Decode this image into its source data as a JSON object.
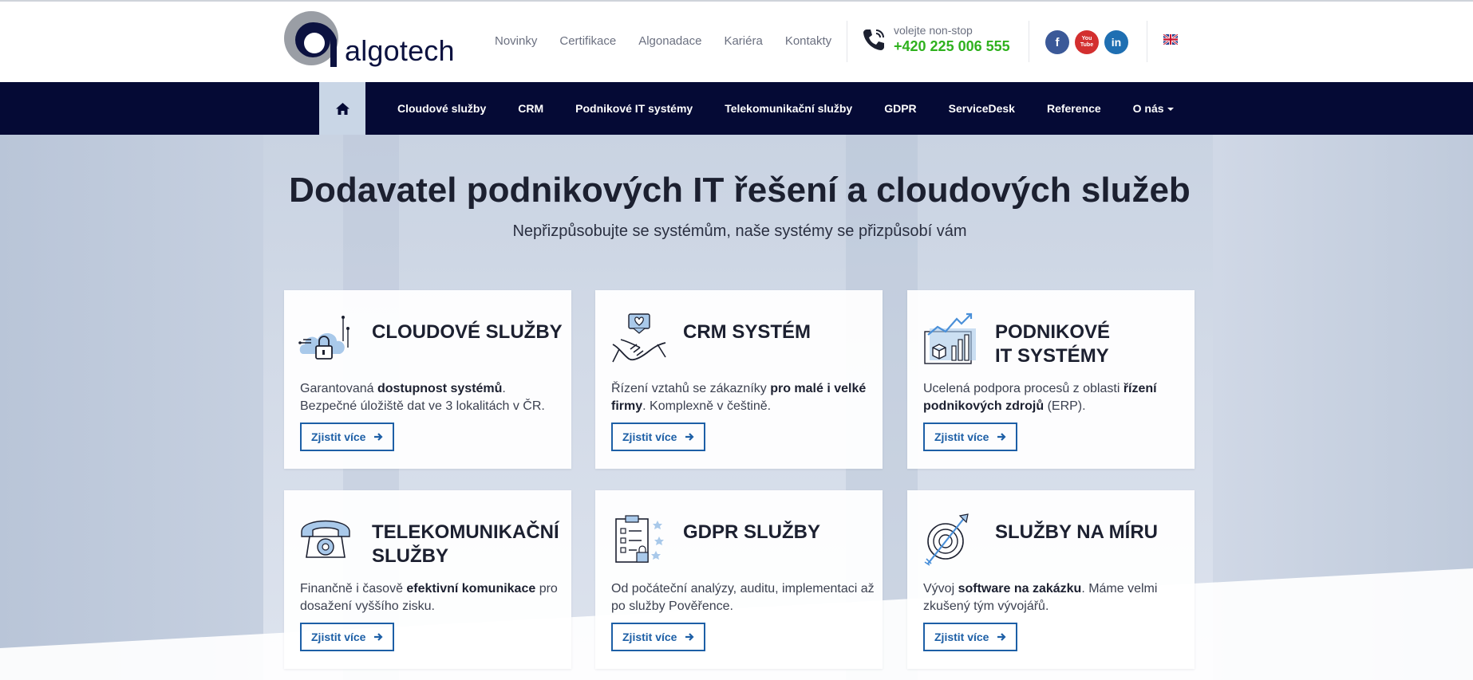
{
  "brand": {
    "logo_text": "algotech"
  },
  "top_links": [
    "Novinky",
    "Certifikace",
    "Algonadace",
    "Kariéra",
    "Kontakty"
  ],
  "contact": {
    "label": "volejte non-stop",
    "phone": "+420 225 006 555"
  },
  "social": {
    "facebook": "f",
    "youtube_top": "You",
    "youtube_bottom": "Tube",
    "linkedin": "in"
  },
  "nav": {
    "items": [
      "Cloudové služby",
      "CRM",
      "Podnikové IT systémy",
      "Telekomunikační služby",
      "GDPR",
      "ServiceDesk",
      "Reference",
      "O nás"
    ]
  },
  "hero": {
    "title_p1": "Dodavatel podnikových ",
    "title_b1": "IT řešení",
    "title_p2": " a ",
    "title_b2": "cloudových služeb",
    "subtitle": "Nepřizpůsobujte se systémům, naše systémy se přizpůsobí vám"
  },
  "cards": [
    {
      "title": "CLOUDOVÉ SLUŽBY",
      "t1": "Garantovaná ",
      "b1": "dostupnost systémů",
      "t2": ". Bezpečné úložiště dat ve 3 lokalitách v ČR.",
      "b2": "",
      "t3": "",
      "button": "Zjistit více",
      "icon": "cloud-lock-icon"
    },
    {
      "title": "CRM SYSTÉM",
      "t1": "Řízení vztahů se zákazníky ",
      "b1": "pro malé i velké firmy",
      "t2": ". Komplexně v češtině.",
      "b2": "",
      "t3": "",
      "button": "Zjistit více",
      "icon": "handshake-icon"
    },
    {
      "title": "PODNIKOVÉ IT SYSTÉMY",
      "t1": "Ucelená podpora procesů z oblasti ",
      "b1": "řízení podnikových zdrojů",
      "t2": " (ERP).",
      "b2": "",
      "t3": "",
      "button": "Zjistit více",
      "icon": "growth-chart-icon"
    },
    {
      "title": "TELEKOMUNIKAČNÍ SLUŽBY",
      "t1": "Finančně i časově ",
      "b1": "efektivní komunikace",
      "t2": " pro dosažení vyššího zisku.",
      "b2": "",
      "t3": "",
      "button": "Zjistit více",
      "icon": "telephone-icon"
    },
    {
      "title": "GDPR SLUŽBY",
      "t1": "Od počáteční analýzy, auditu, implementaci až po služby Pověřence.",
      "b1": "",
      "t2": "",
      "b2": "",
      "t3": "",
      "button": "Zjistit více",
      "icon": "gdpr-checklist-icon"
    },
    {
      "title": "SLUŽBY NA MÍRU",
      "t1": "Vývoj ",
      "b1": "software na zakázku",
      "t2": ". Máme velmi zkušený tým vývojářů.",
      "b2": "",
      "t3": "",
      "button": "Zjistit více",
      "icon": "target-icon"
    }
  ],
  "colors": {
    "nav_bg": "#050a35",
    "accent_green": "#2fb11e",
    "button_blue": "#1d5fa6",
    "facebook": "#3b5998",
    "youtube": "#d32f2f",
    "linkedin": "#1f6fb2"
  }
}
